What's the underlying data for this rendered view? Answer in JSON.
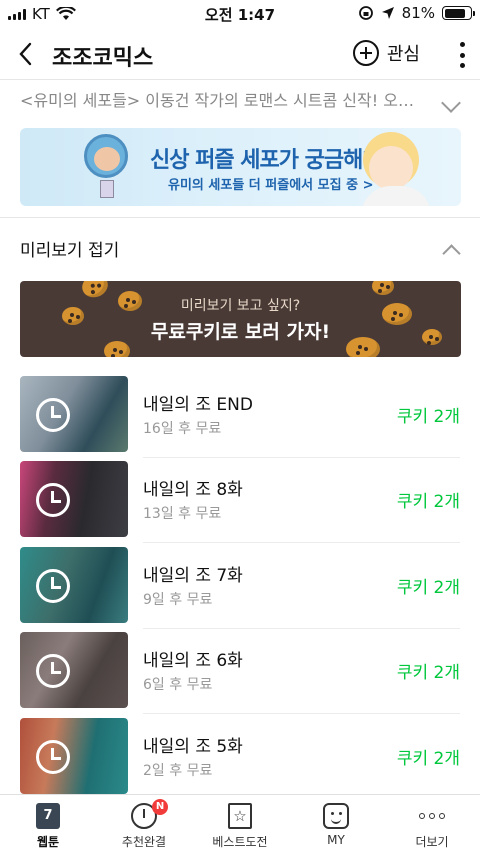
{
  "status_bar": {
    "carrier": "KT",
    "time": "오전 1:47",
    "battery": "81%",
    "battery_level": 0.81
  },
  "header": {
    "title": "조조코믹스",
    "follow_label": "관심"
  },
  "description": "<유미의 세포들> 이동건 작가의 로맨스 시트콤 신작! 오…",
  "promo_banner": {
    "headline": "신상 퍼즐 세포가 궁금해?",
    "subtext": "유미의 세포들 더 퍼즐에서 모집 중 >"
  },
  "preview": {
    "toggle_label": "미리보기 접기",
    "cookie_banner": {
      "small": "미리보기 보고 싶지?",
      "big": "무료쿠키로 보러 가자!"
    }
  },
  "episodes": [
    {
      "title": "내일의 조 END",
      "sub": "16일 후 무료",
      "price": "쿠키 2개"
    },
    {
      "title": "내일의 조 8화",
      "sub": "13일 후 무료",
      "price": "쿠키 2개"
    },
    {
      "title": "내일의 조 7화",
      "sub": "9일 후 무료",
      "price": "쿠키 2개"
    },
    {
      "title": "내일의 조 6화",
      "sub": "6일 후 무료",
      "price": "쿠키 2개"
    },
    {
      "title": "내일의 조 5화",
      "sub": "2일 후 무료",
      "price": "쿠키 2개"
    }
  ],
  "tab_bar": {
    "webtoon_day": "7",
    "new_badge": "N",
    "tabs": [
      {
        "label": "웹툰",
        "icon": "webtoon-calendar-icon"
      },
      {
        "label": "추천완결",
        "icon": "completed-icon"
      },
      {
        "label": "베스트도전",
        "icon": "best-challenge-icon"
      },
      {
        "label": "MY",
        "icon": "my-icon"
      },
      {
        "label": "더보기",
        "icon": "more-icon"
      }
    ]
  },
  "colors": {
    "price_green": "#00c73c",
    "cookie_banner_bg": "#4a3a36",
    "promo_blue": "#1e63ad"
  }
}
